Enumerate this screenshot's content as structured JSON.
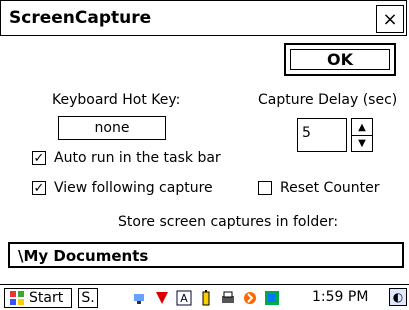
{
  "window": {
    "title": "ScreenCapture",
    "close_label": "×"
  },
  "buttons": {
    "ok": "OK"
  },
  "labels": {
    "keyboard_hotkey": "Keyboard Hot Key:",
    "capture_delay": "Capture Delay (sec)",
    "store_folder": "Store screen captures in folder:"
  },
  "fields": {
    "hotkey_value": "none",
    "delay_value": "5",
    "folder_path": "\\My Documents"
  },
  "options": {
    "auto_run": {
      "label": "Auto run in the task bar",
      "checked": true
    },
    "view_following": {
      "label": "View following capture",
      "checked": true
    },
    "reset_counter": {
      "label": "Reset Counter",
      "checked": false
    }
  },
  "taskbar": {
    "start_label": "Start",
    "s_label": "S.",
    "time": "1:59 PM",
    "tray_icons": [
      "network-icon",
      "signal-icon",
      "input-a-icon",
      "battery-icon",
      "printer-icon",
      "bluetooth-icon",
      "wifi-icon"
    ]
  }
}
